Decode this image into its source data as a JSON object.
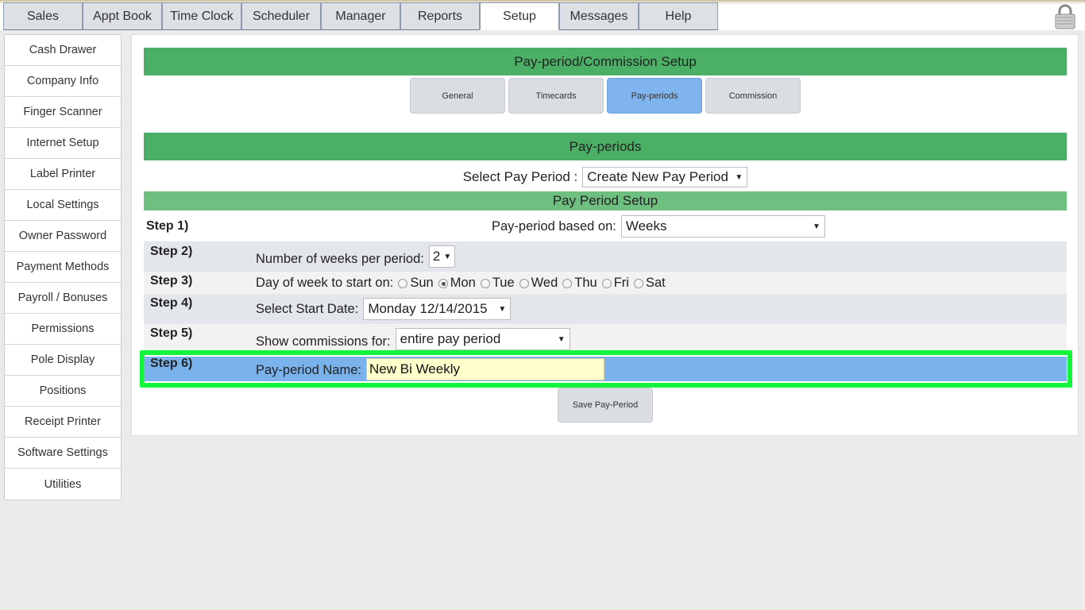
{
  "topnav": {
    "tabs": [
      "Sales",
      "Appt Book",
      "Time Clock",
      "Scheduler",
      "Manager",
      "Reports",
      "Setup",
      "Messages",
      "Help"
    ],
    "active": "Setup"
  },
  "sidebar": {
    "items": [
      "Cash Drawer",
      "Company Info",
      "Finger Scanner",
      "Internet Setup",
      "Label Printer",
      "Local Settings",
      "Owner Password",
      "Payment Methods",
      "Payroll / Bonuses",
      "Permissions",
      "Pole Display",
      "Positions",
      "Receipt Printer",
      "Software Settings",
      "Utilities"
    ]
  },
  "main": {
    "title": "Pay-period/Commission Setup",
    "subtabs": [
      "General",
      "Timecards",
      "Pay-periods",
      "Commission"
    ],
    "active_subtab": "Pay-periods",
    "section_title": "Pay-periods",
    "select_pay_period_label": "Select Pay Period :",
    "select_pay_period_value": "Create New Pay Period",
    "setup_title": "Pay Period Setup",
    "steps": {
      "s1_label": "Step 1)",
      "s1_text": "Pay-period based on:",
      "s1_value": "Weeks",
      "s2_label": "Step 2)",
      "s2_text": "Number of weeks per period:",
      "s2_value": "2",
      "s3_label": "Step 3)",
      "s3_text": "Day of week to start on:",
      "s3_days": [
        "Sun",
        "Mon",
        "Tue",
        "Wed",
        "Thu",
        "Fri",
        "Sat"
      ],
      "s3_selected": "Mon",
      "s4_label": "Step 4)",
      "s4_text": "Select Start Date:",
      "s4_value": "Monday 12/14/2015",
      "s5_label": "Step 5)",
      "s5_text": "Show commissions for:",
      "s5_value": "entire pay period",
      "s6_label": "Step 6)",
      "s6_text": "Pay-period Name:",
      "s6_value": "New Bi Weekly"
    },
    "save_label": "Save Pay-Period"
  },
  "colors": {
    "green_header": "#4caf66",
    "light_green": "#6fc080",
    "active_blue": "#7fb4ee",
    "highlight": "#13f43c",
    "input_yellow": "#ffffcc"
  },
  "icons": {
    "lock": "lock-icon"
  }
}
